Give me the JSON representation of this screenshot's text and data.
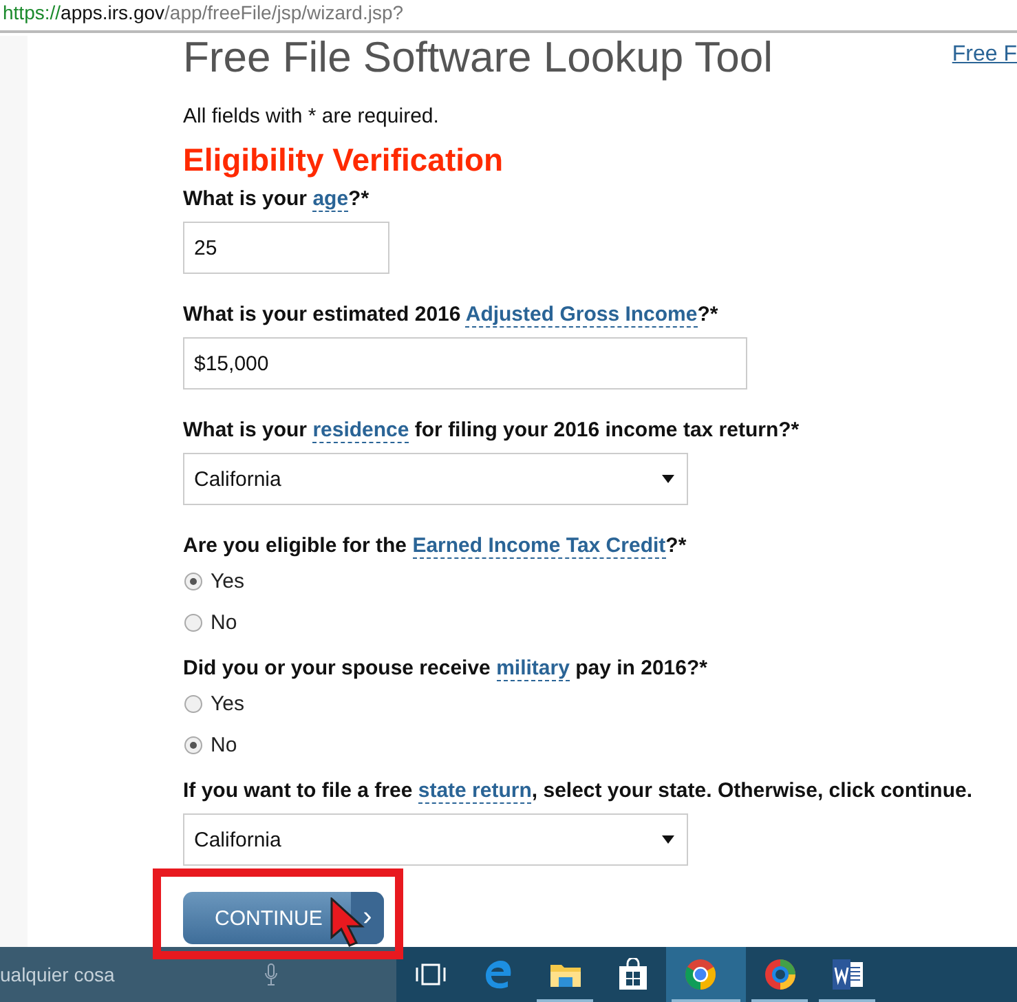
{
  "address_bar": {
    "scheme": "https://",
    "host": "apps.irs.gov",
    "path": "/app/freeFile/jsp/wizard.jsp?"
  },
  "page": {
    "title": "Free File Software Lookup Tool",
    "top_link": "Free F",
    "required_note": "All fields with * are required.",
    "section_title": "Eligibility Verification"
  },
  "questions": [
    {
      "kind": "text",
      "prefix": "What is your ",
      "term": "age",
      "suffix": "?*",
      "value": "25"
    },
    {
      "kind": "text",
      "prefix": "What is your estimated 2016 ",
      "term": "Adjusted Gross Income",
      "suffix": "?*",
      "value": "$15,000"
    },
    {
      "kind": "select",
      "prefix": "What is your ",
      "term": "residence",
      "suffix": " for filing your 2016 income tax return?*",
      "value": "California"
    },
    {
      "kind": "radio",
      "prefix": "Are you eligible for the ",
      "term": "Earned Income Tax Credit",
      "suffix": "?*",
      "options": [
        {
          "label": "Yes",
          "selected": true
        },
        {
          "label": "No",
          "selected": false
        }
      ]
    },
    {
      "kind": "radio",
      "prefix": "Did you or your spouse receive ",
      "term": "military",
      "suffix": " pay in 2016?*",
      "options": [
        {
          "label": "Yes",
          "selected": false
        },
        {
          "label": "No",
          "selected": true
        }
      ]
    },
    {
      "kind": "select",
      "prefix": "If you want to file a free ",
      "term": "state return",
      "suffix": ", select your state. Otherwise, click continue.",
      "value": "California"
    }
  ],
  "continue_button": {
    "label": "CONTINUE",
    "arrow": "›"
  },
  "taskbar": {
    "search_text": "ualquier cosa",
    "apps": [
      {
        "kind": "taskview",
        "running": false,
        "selected": false
      },
      {
        "kind": "edge",
        "running": false,
        "selected": false
      },
      {
        "kind": "folder",
        "running": true,
        "selected": false
      },
      {
        "kind": "store",
        "running": false,
        "selected": false
      },
      {
        "kind": "chrome",
        "running": true,
        "selected": true
      },
      {
        "kind": "ring",
        "running": true,
        "selected": false
      },
      {
        "kind": "word",
        "running": true,
        "selected": false
      }
    ]
  }
}
